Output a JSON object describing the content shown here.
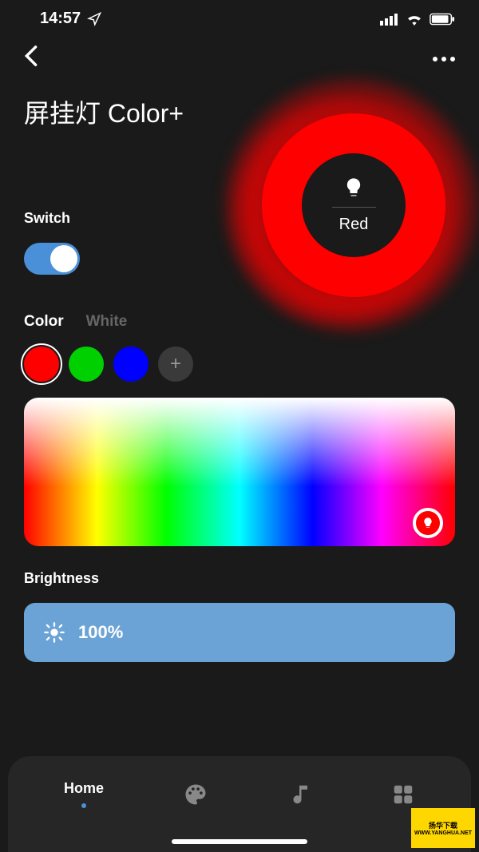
{
  "status_bar": {
    "time": "14:57"
  },
  "device": {
    "title": "屏挂灯 Color+",
    "current_color_name": "Red",
    "current_color_hex": "#ff0000"
  },
  "switch": {
    "label": "Switch",
    "on": true
  },
  "tabs": {
    "color": "Color",
    "white": "White",
    "active": "color"
  },
  "color_presets": [
    {
      "hex": "#ff0000",
      "selected": true
    },
    {
      "hex": "#00d000",
      "selected": false
    },
    {
      "hex": "#0000ff",
      "selected": false
    }
  ],
  "brightness": {
    "label": "Brightness",
    "value": "100%"
  },
  "bottom_nav": {
    "home": "Home"
  },
  "watermark": {
    "line1": "扬华下载",
    "line2": "WWW.YANGHUA.NET"
  }
}
